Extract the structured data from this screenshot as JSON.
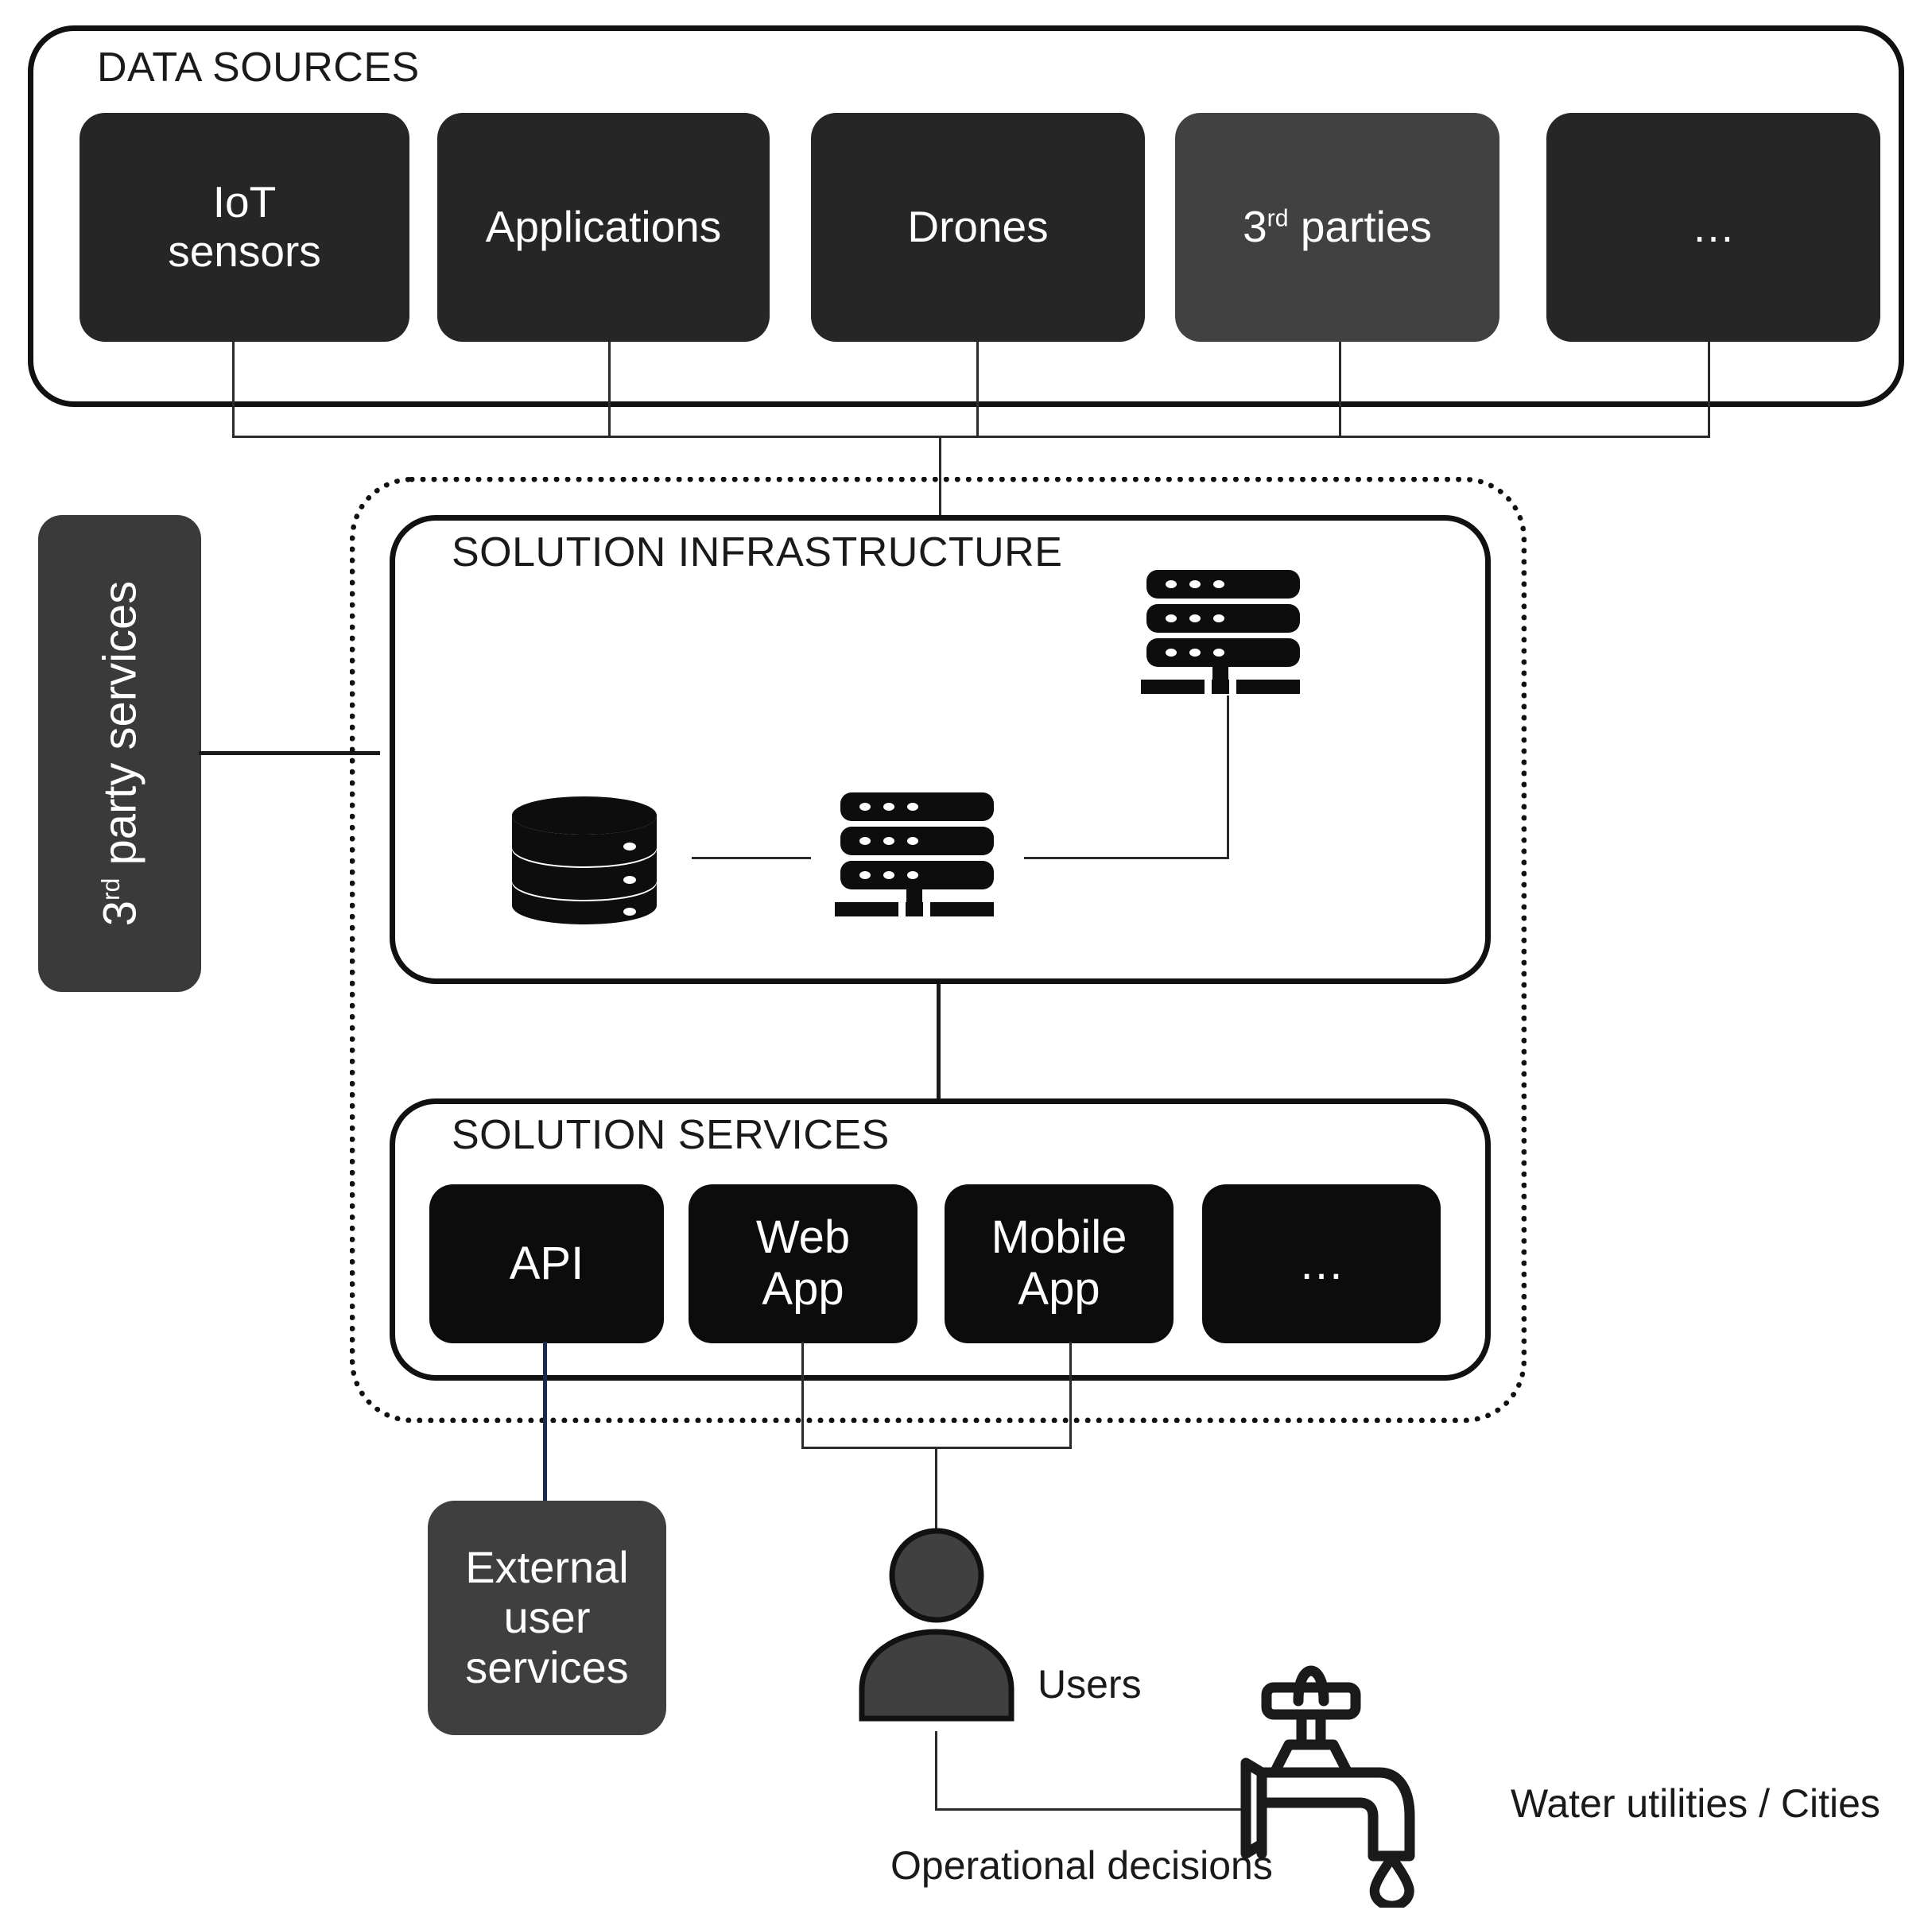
{
  "diagram": {
    "title_data_sources": "DATA SOURCES",
    "title_solution_infrastructure": "SOLUTION INFRASTRUCTURE",
    "title_solution_services": "SOLUTION SERVICES"
  },
  "data_sources": {
    "label": "DATA SOURCES",
    "items": [
      {
        "id": "iot-sensors",
        "line1": "IoT",
        "line2": "sensors",
        "fill": "#262626",
        "highlight": false
      },
      {
        "id": "applications",
        "line1": "Applications",
        "line2": "",
        "fill": "#262626",
        "highlight": false
      },
      {
        "id": "drones",
        "line1": "Drones",
        "line2": "",
        "fill": "#262626",
        "highlight": false
      },
      {
        "id": "third-parties",
        "line1": "3",
        "sup": "rd",
        "line1b": " parties",
        "line2": "",
        "fill": "#414141",
        "highlight": true
      },
      {
        "id": "more",
        "line1": "…",
        "line2": "",
        "fill": "#262626",
        "highlight": false
      }
    ]
  },
  "third_party_services": {
    "prefix": "3",
    "sup": "rd",
    "suffix": " party services",
    "fill": "#3a3a3a"
  },
  "solution_infrastructure": {
    "label": "SOLUTION INFRASTRUCTURE",
    "icons": [
      {
        "id": "database-icon",
        "name": "database-cylinder"
      },
      {
        "id": "server-icon-main",
        "name": "server-rack"
      },
      {
        "id": "server-icon-upper",
        "name": "server-rack"
      }
    ]
  },
  "solution_services": {
    "label": "SOLUTION SERVICES",
    "items": [
      {
        "id": "api",
        "line1": "API",
        "line2": ""
      },
      {
        "id": "web-app",
        "line1": "Web",
        "line2": "App"
      },
      {
        "id": "mobile-app",
        "line1": "Mobile",
        "line2": "App"
      },
      {
        "id": "more",
        "line1": "…",
        "line2": ""
      }
    ]
  },
  "external_user_services": {
    "line1": "External",
    "line2": "user",
    "line3": "services",
    "fill": "#3f3f3f"
  },
  "actors": {
    "users_label": "Users",
    "operational_decisions_label": "Operational decisions",
    "water_utilities_label": "Water utilities / Cities"
  },
  "colors": {
    "card_dark": "#262626",
    "card_highlight": "#414141",
    "service_card": "#0c0c0c",
    "gray_box": "#3f3f3f",
    "outline": "#111111",
    "api_link": "#1c2a4d",
    "line": "#2b2b2b"
  }
}
